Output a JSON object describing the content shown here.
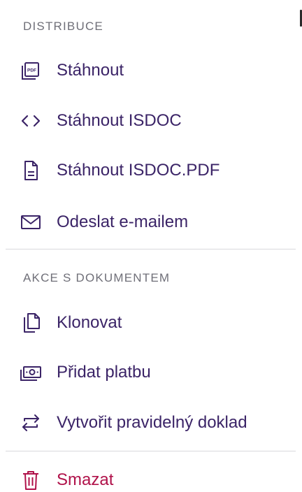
{
  "sections": [
    {
      "header": "DISTRIBUCE",
      "items": [
        {
          "label": "Stáhnout",
          "icon": "pdf-icon"
        },
        {
          "label": "Stáhnout ISDOC",
          "icon": "code-icon"
        },
        {
          "label": "Stáhnout ISDOC.PDF",
          "icon": "document-icon"
        },
        {
          "label": "Odeslat e-mailem",
          "icon": "mail-icon"
        }
      ]
    },
    {
      "header": "AKCE S DOKUMENTEM",
      "items": [
        {
          "label": "Klonovat",
          "icon": "copy-icon"
        },
        {
          "label": "Přidat platbu",
          "icon": "payment-icon"
        },
        {
          "label": "Vytvořit pravidelný doklad",
          "icon": "repeat-icon"
        }
      ]
    }
  ],
  "delete_item": {
    "label": "Smazat",
    "icon": "trash-icon"
  },
  "colors": {
    "item_text": "#3b2467",
    "header_text": "#6f6f78",
    "danger": "#b0124a",
    "divider": "#d9d9dd"
  }
}
